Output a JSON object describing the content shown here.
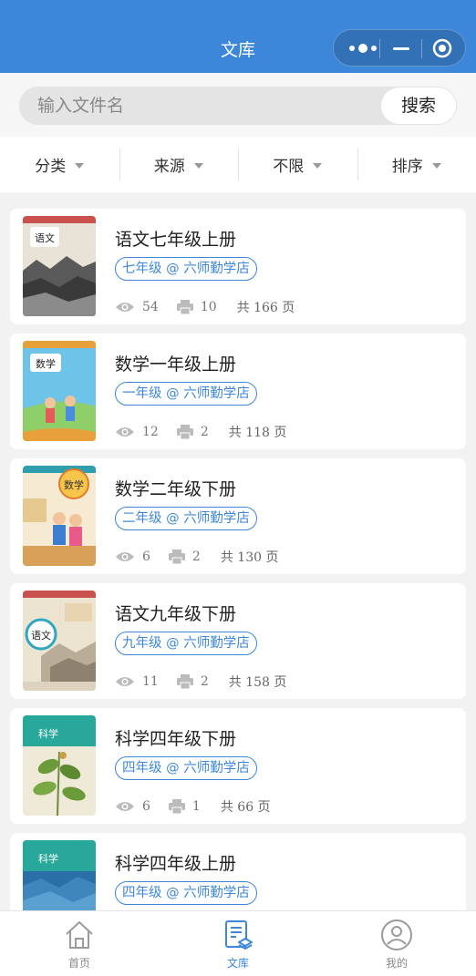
{
  "header": {
    "title": "文库"
  },
  "search": {
    "placeholder": "输入文件名",
    "button": "搜索"
  },
  "filters": [
    {
      "label": "分类"
    },
    {
      "label": "来源"
    },
    {
      "label": "不限"
    },
    {
      "label": "排序"
    }
  ],
  "documents": [
    {
      "title": "语文七年级上册",
      "tag": "七年级 @ 六师勤学店",
      "views": "54",
      "prints": "10",
      "pages": "共 166 页",
      "cover_text": "语文",
      "cover_color": "#c9524f"
    },
    {
      "title": "数学一年级上册",
      "tag": "一年级 @ 六师勤学店",
      "views": "12",
      "prints": "2",
      "pages": "共 118 页",
      "cover_text": "数学",
      "cover_color": "#e8a13a"
    },
    {
      "title": "数学二年级下册",
      "tag": "二年级 @ 六师勤学店",
      "views": "6",
      "prints": "2",
      "pages": "共 130 页",
      "cover_text": "数学",
      "cover_color": "#2f9fb0"
    },
    {
      "title": "语文九年级下册",
      "tag": "九年级 @ 六师勤学店",
      "views": "11",
      "prints": "2",
      "pages": "共 158 页",
      "cover_text": "语文",
      "cover_color": "#c9524f"
    },
    {
      "title": "科学四年级下册",
      "tag": "四年级 @ 六师勤学店",
      "views": "6",
      "prints": "1",
      "pages": "共 66 页",
      "cover_text": "科学",
      "cover_color": "#27a89a"
    },
    {
      "title": "科学四年级上册",
      "tag": "四年级 @ 六师勤学店",
      "views": "",
      "prints": "",
      "pages": "",
      "cover_text": "科学",
      "cover_color": "#27a89a"
    }
  ],
  "tabbar": [
    {
      "label": "首页",
      "icon": "home-icon",
      "active": false
    },
    {
      "label": "文库",
      "icon": "library-icon",
      "active": true
    },
    {
      "label": "我的",
      "icon": "user-icon",
      "active": false
    }
  ],
  "colors": {
    "primary": "#3c87d9",
    "background": "#f2f2f2"
  }
}
